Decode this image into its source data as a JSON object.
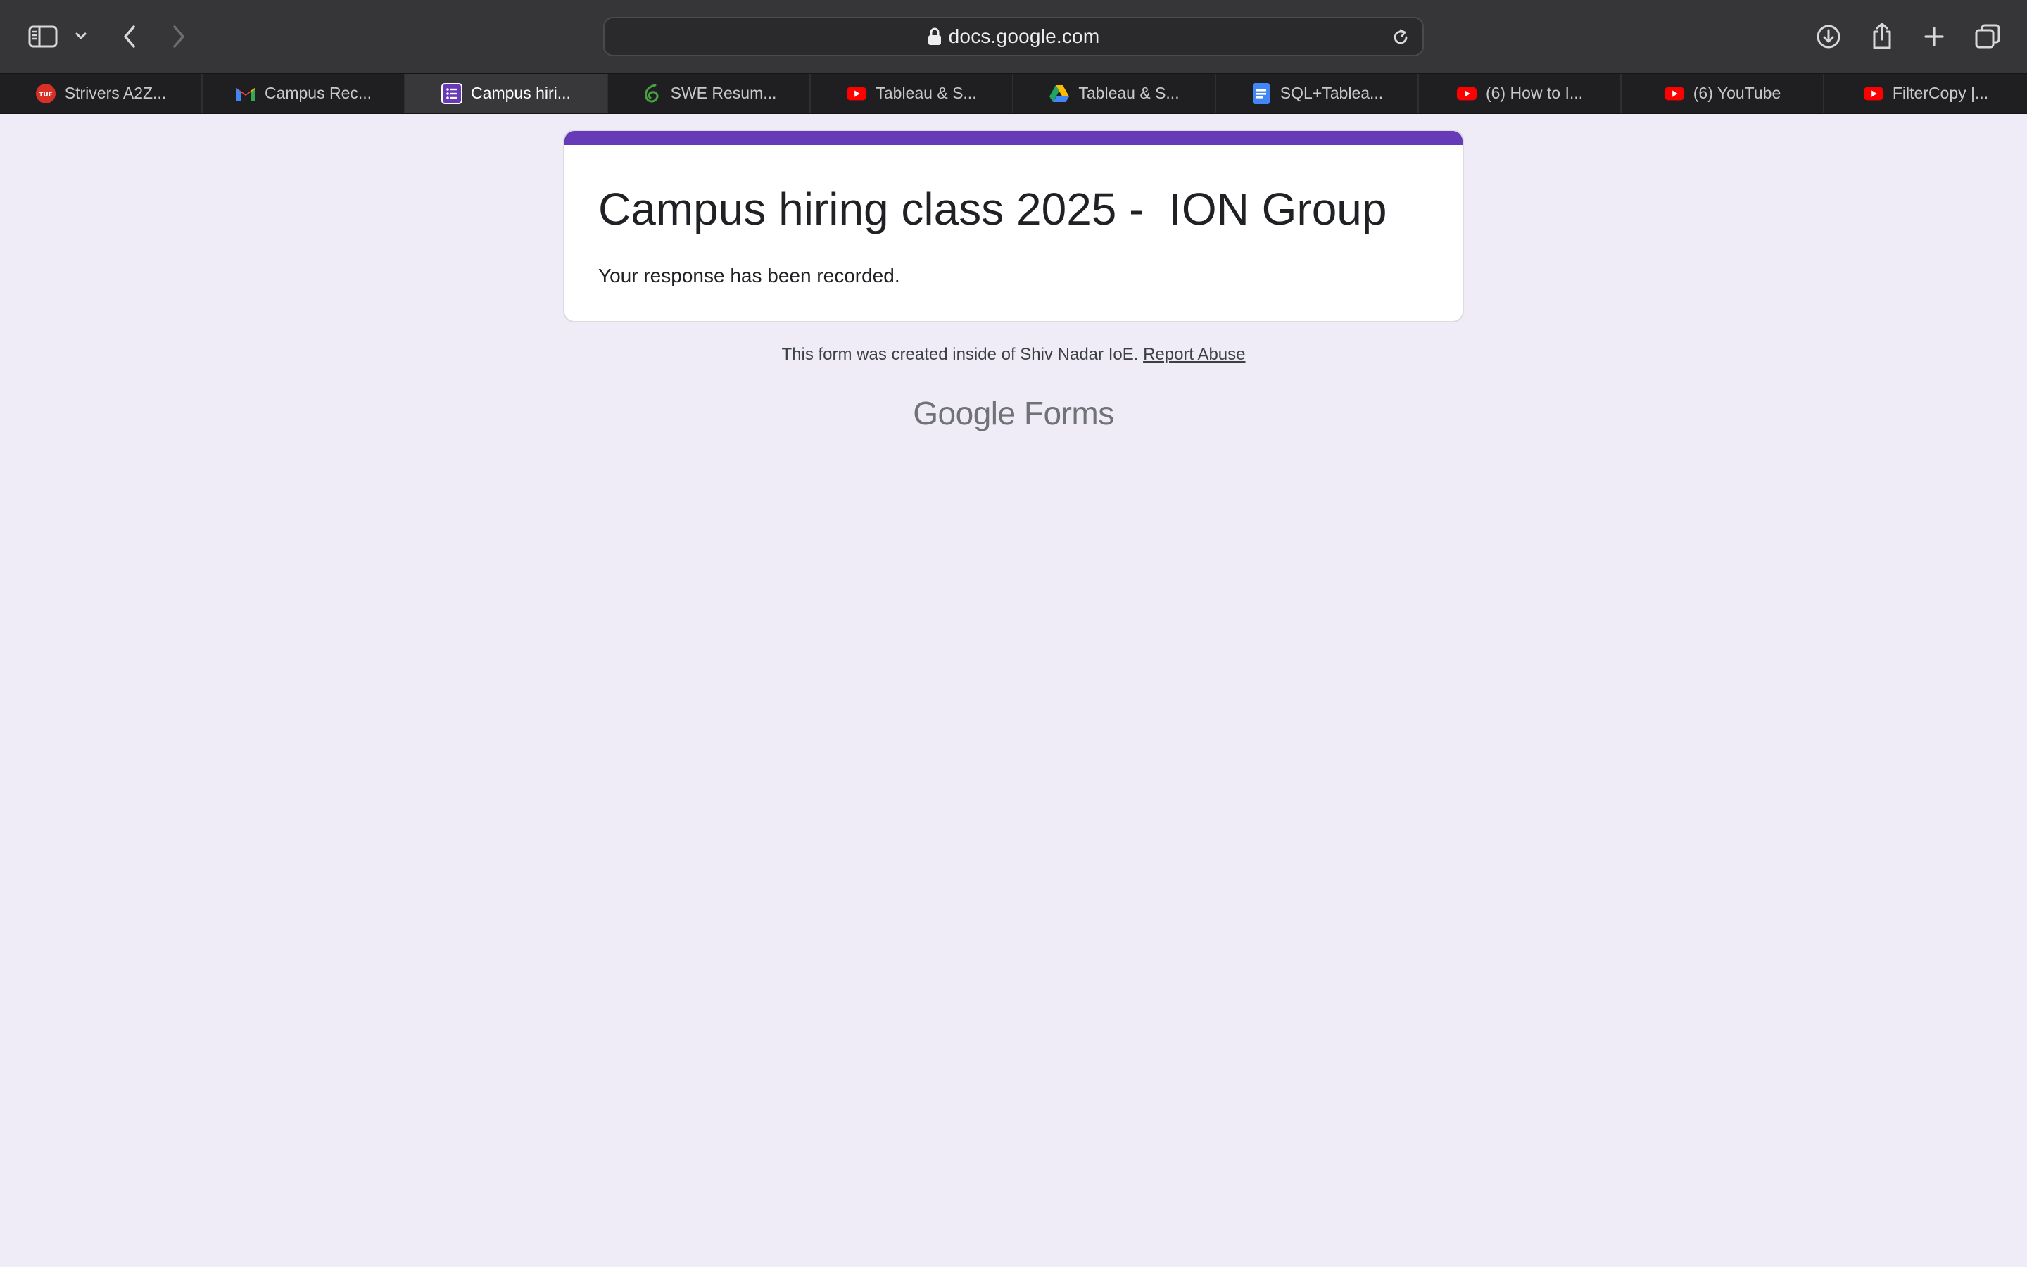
{
  "browser": {
    "url": "docs.google.com",
    "tabs": [
      {
        "label": "Strivers A2Z...",
        "icon": "tuf-icon",
        "color": "#d93025",
        "active": false
      },
      {
        "label": "Campus Rec...",
        "icon": "gmail-icon",
        "color": "#ea4335",
        "active": false
      },
      {
        "label": "Campus hiri...",
        "icon": "google-forms-icon",
        "color": "#673ab7",
        "active": true
      },
      {
        "label": "SWE Resum...",
        "icon": "overleaf-icon",
        "color": "#47a141",
        "active": false
      },
      {
        "label": "Tableau & S...",
        "icon": "youtube-icon",
        "color": "#ff0000",
        "active": false
      },
      {
        "label": "Tableau & S...",
        "icon": "google-drive-icon",
        "color": "#1fa463",
        "active": false
      },
      {
        "label": "SQL+Tablea...",
        "icon": "google-docs-icon",
        "color": "#4285f4",
        "active": false
      },
      {
        "label": "(6) How to I...",
        "icon": "youtube-icon",
        "color": "#ff0000",
        "active": false
      },
      {
        "label": "(6) YouTube",
        "icon": "youtube-icon",
        "color": "#ff0000",
        "active": false
      },
      {
        "label": "FilterCopy |...",
        "icon": "youtube-icon",
        "color": "#ff0000",
        "active": false
      }
    ]
  },
  "form": {
    "title": "Campus hiring class 2025 -  ION Group",
    "message": "Your response has been recorded.",
    "accent_color": "#673ab7"
  },
  "footer": {
    "note": "This form was created inside of Shiv Nadar IoE.",
    "report_link": "Report Abuse",
    "logo_google": "Google",
    "logo_forms": "Forms"
  }
}
